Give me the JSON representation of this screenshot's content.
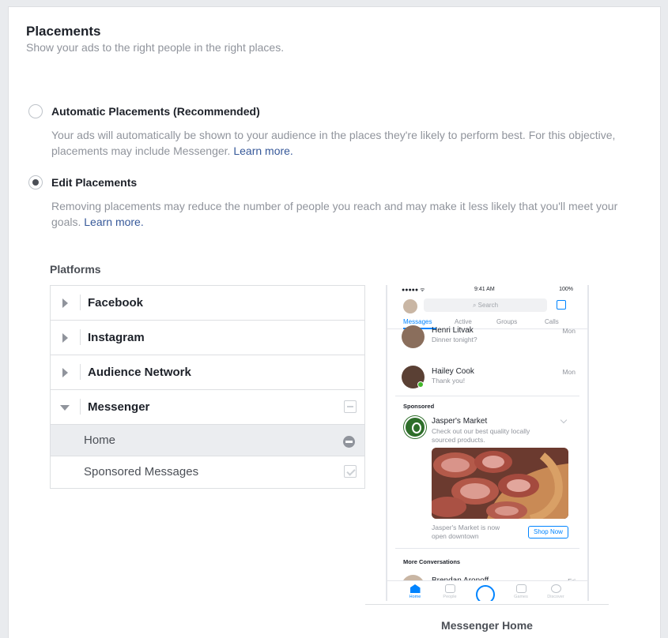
{
  "header": {
    "title": "Placements",
    "subtitle": "Show your ads to the right people in the right places."
  },
  "options": {
    "automatic": {
      "label": "Automatic Placements (Recommended)",
      "description": "Your ads will automatically be shown to your audience in the places they're likely to perform best. For this objective, placements may include Messenger.",
      "link": "Learn more.",
      "selected": false
    },
    "edit": {
      "label": "Edit Placements",
      "description": "Removing placements may reduce the number of people you reach and may make it less likely that you'll meet your goals.",
      "link": "Learn more.",
      "selected": true
    }
  },
  "platforms": {
    "title": "Platforms",
    "items": [
      {
        "label": "Facebook",
        "expanded": false
      },
      {
        "label": "Instagram",
        "expanded": false
      },
      {
        "label": "Audience Network",
        "expanded": false
      },
      {
        "label": "Messenger",
        "expanded": true
      }
    ],
    "messenger_sub": [
      {
        "label": "Home",
        "state": "highlighted"
      },
      {
        "label": "Sponsored Messages",
        "state": "checked"
      }
    ]
  },
  "preview": {
    "caption": "Messenger Home",
    "status": {
      "signal": "●●●●● ᯤ",
      "time": "9:41 AM",
      "battery": "100%"
    },
    "search_placeholder": "Search",
    "tabs": [
      "Messages",
      "Active",
      "Groups",
      "Calls"
    ],
    "conversations": [
      {
        "name": "Henri Litvak",
        "message": "Dinner tonight?",
        "time": "Mon"
      },
      {
        "name": "Hailey Cook",
        "message": "Thank you!",
        "time": "Mon"
      }
    ],
    "sponsored_label": "Sponsored",
    "ad": {
      "name": "Jasper's Market",
      "text": "Check out our best quality locally sourced products.",
      "note": "Jasper's Market is now open downtown",
      "cta": "Shop Now"
    },
    "more_label": "More Conversations",
    "more_conversation": {
      "name": "Brendan Aronoff",
      "time": "Fri"
    },
    "nav": [
      "Home",
      "People",
      "",
      "Games",
      "Discover"
    ]
  },
  "colors": {
    "link": "#365899",
    "messenger_blue": "#0084ff",
    "muted_text": "#90949c"
  }
}
